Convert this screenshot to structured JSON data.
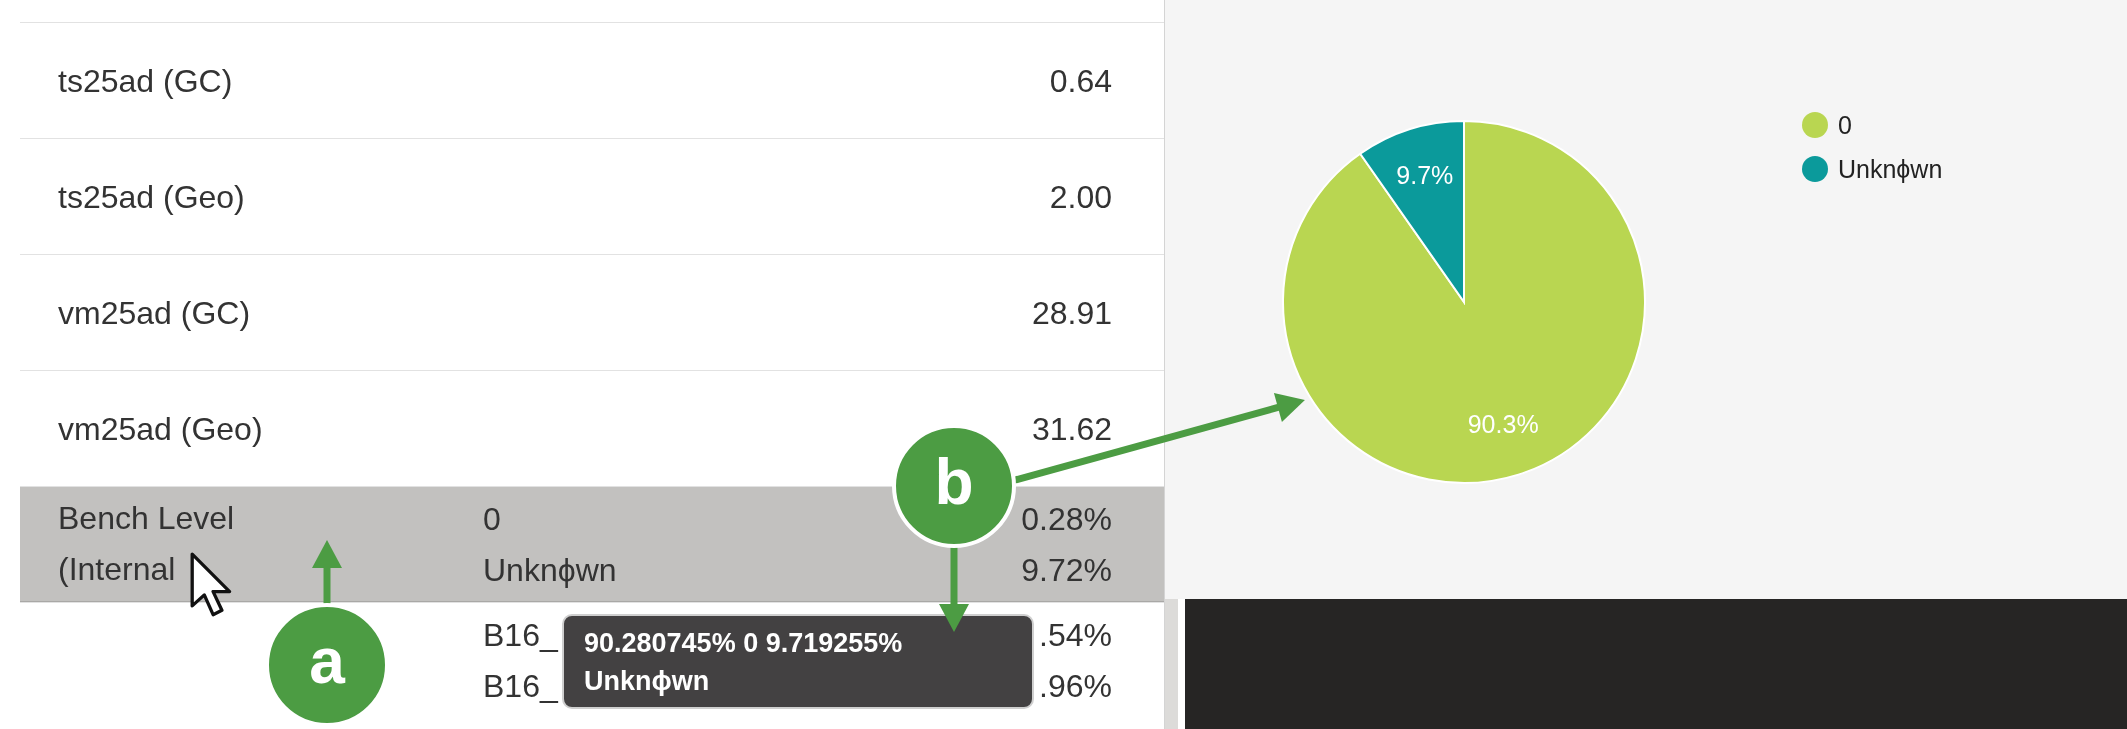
{
  "table": {
    "rows": [
      {
        "kind": "metric",
        "label": "ts25ad (GC)",
        "value": "0.64",
        "selected": false
      },
      {
        "kind": "metric",
        "label": "ts25ad (Geo)",
        "value": "2.00",
        "selected": false
      },
      {
        "kind": "metric",
        "label": "vm25ad (GC)",
        "value": "28.91",
        "selected": false
      },
      {
        "kind": "metric",
        "label": "vm25ad (Geo)",
        "value": "31.62",
        "selected": false
      },
      {
        "kind": "breakdown",
        "label_lines": [
          "Bench Level",
          "(Internal"
        ],
        "entries": [
          {
            "name": "0",
            "value": "0.28%"
          },
          {
            "name": "Unknϕwn",
            "value": "9.72%"
          }
        ],
        "selected": true
      },
      {
        "kind": "breakdown",
        "entries": [
          {
            "name": "B16_",
            "value": ".54%"
          },
          {
            "name": "B16_",
            "value": ".96%"
          }
        ],
        "selected": false
      }
    ]
  },
  "tooltip": {
    "text": "90.280745% 0 9.719255% Unknϕwn"
  },
  "chart": {
    "chart_data": {
      "type": "pie",
      "categories": [
        "0",
        "Unknϕwn"
      ],
      "values": [
        90.280745,
        9.719255
      ],
      "colors": [
        "#b9d651",
        "#0b9a9b"
      ],
      "value_labels": [
        "90.3%",
        "9.7%"
      ],
      "legend": "right"
    }
  },
  "annotations": [
    {
      "label": "a"
    },
    {
      "label": "b"
    }
  ]
}
